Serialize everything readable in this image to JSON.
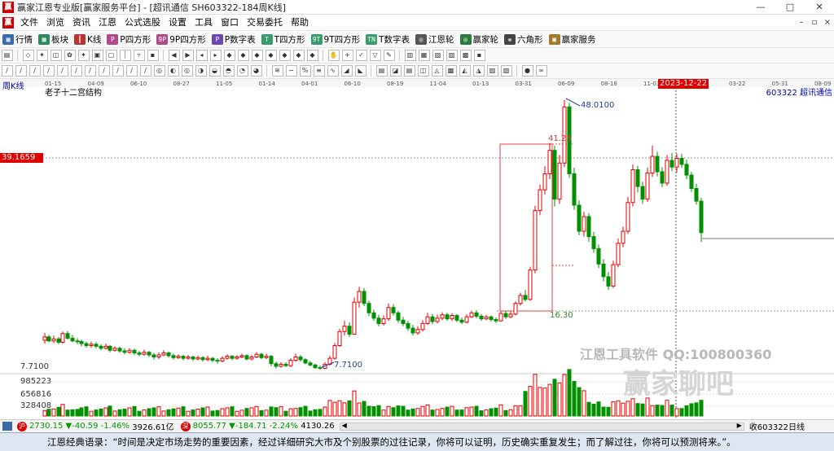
{
  "window": {
    "title": "赢家江恩专业版[赢家服务平台] - [超讯通信  SH603322-184周K线]",
    "app_icon": "赢",
    "controls": [
      "—",
      "□",
      "✕"
    ]
  },
  "menu": {
    "items": [
      "文件",
      "浏览",
      "资讯",
      "江恩",
      "公式选股",
      "设置",
      "工具",
      "窗口",
      "交易委托",
      "帮助"
    ],
    "mdi_controls": [
      "–",
      "▫",
      "×"
    ]
  },
  "toolbar1": [
    {
      "icon": "grid-icon",
      "glyph": "▦",
      "color": "#3a6aa8",
      "label": "行情"
    },
    {
      "icon": "blocks-icon",
      "glyph": "▦",
      "color": "#2a8a5a",
      "label": "板块"
    },
    {
      "icon": "kline-icon",
      "glyph": "┃",
      "color": "#c03030",
      "label": "K线"
    },
    {
      "icon": "p-square-icon",
      "glyph": "P",
      "color": "#b04a8a",
      "label": "P四方形"
    },
    {
      "icon": "9p-square-icon",
      "glyph": "9P",
      "color": "#b04a8a",
      "label": "9P四方形"
    },
    {
      "icon": "p-table-icon",
      "glyph": "P",
      "color": "#6a4ab0",
      "label": "P数字表"
    },
    {
      "icon": "t-square-icon",
      "glyph": "T",
      "color": "#3a9a6a",
      "label": "T四方形"
    },
    {
      "icon": "9t-square-icon",
      "glyph": "9T",
      "color": "#3a9a6a",
      "label": "9T四方形"
    },
    {
      "icon": "t-table-icon",
      "glyph": "TN",
      "color": "#3a9a6a",
      "label": "T数字表"
    },
    {
      "icon": "gann-wheel-icon",
      "glyph": "◎",
      "color": "#555",
      "label": "江恩轮"
    },
    {
      "icon": "winner-wheel-icon",
      "glyph": "◎",
      "color": "#2a7a3a",
      "label": "赢家轮"
    },
    {
      "icon": "hexagon-icon",
      "glyph": "❋",
      "color": "#444",
      "label": "六角形"
    },
    {
      "icon": "service-icon",
      "glyph": "▣",
      "color": "#a07a2a",
      "label": "赢家服务"
    }
  ],
  "chart": {
    "period_label": "周K线",
    "structure_label": "老子十二宫结构",
    "stock_label": "603322 超讯通信",
    "price_tag": "39.1659",
    "date_tag": "2023-12-22",
    "level_box_top": "41.25",
    "level_box_bottom": "16.30",
    "peak": "48.0100",
    "low": "7.7100",
    "scale_low": "7.7100",
    "volume_scale": [
      "985223",
      "656816",
      "328408"
    ],
    "timeline": [
      "01-15",
      "04-09",
      "06-10",
      "08-27",
      "11-05",
      "01-14",
      "04-01",
      "06-10",
      "08-19",
      "11-04",
      "01-13",
      "03-31",
      "06-09",
      "08-18",
      "11-03",
      "2023-12-22",
      "03-22",
      "05-31",
      "08-09"
    ],
    "watermark_1": "江恩工具软件  QQ:100800360",
    "watermark_2": "赢家聊吧",
    "colors": {
      "up": "#e00000",
      "down": "#009000",
      "box": "#e04040",
      "grid": "#999999"
    }
  },
  "indexbar": {
    "sh_badge": "沪",
    "sh_value": "2730.15",
    "sh_change": "▼-40.59",
    "sh_pct": "-1.46%",
    "sh_amount": "3926.61亿",
    "sz_badge": "深",
    "sz_value": "8055.77",
    "sz_change": "▼-184.71",
    "sz_pct": "-2.24%",
    "sz_amount": "4130.26",
    "right_text": "收603322日线"
  },
  "quote": "江恩经典语录：“时间是决定市场走势的重要因素，经过详细研究大市及个别股票的过往记录，你将可以证明，历史确实重复发生；而了解过往，你将可以预测将来。”。"
}
